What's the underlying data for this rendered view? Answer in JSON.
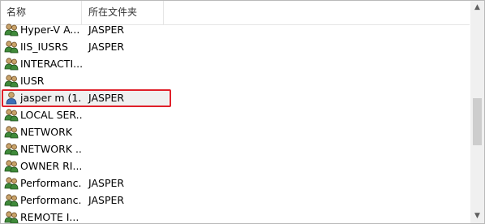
{
  "columns": {
    "name": "名称",
    "folder": "所在文件夹"
  },
  "rows": [
    {
      "name": "Hyper-V A...",
      "folder": "JASPER",
      "icon": "group-icon",
      "selected": false
    },
    {
      "name": "IIS_IUSRS",
      "folder": "JASPER",
      "icon": "group-icon",
      "selected": false
    },
    {
      "name": "INTERACTI...",
      "folder": "",
      "icon": "group-icon",
      "selected": false
    },
    {
      "name": "IUSR",
      "folder": "",
      "icon": "group-icon",
      "selected": false
    },
    {
      "name": "jasper m (1...",
      "folder": "JASPER",
      "icon": "user-icon",
      "selected": true
    },
    {
      "name": "LOCAL SER...",
      "folder": "",
      "icon": "group-icon",
      "selected": false
    },
    {
      "name": "NETWORK",
      "folder": "",
      "icon": "group-icon",
      "selected": false
    },
    {
      "name": "NETWORK ...",
      "folder": "",
      "icon": "group-icon",
      "selected": false
    },
    {
      "name": "OWNER RI...",
      "folder": "",
      "icon": "group-icon",
      "selected": false
    },
    {
      "name": "Performanc...",
      "folder": "JASPER",
      "icon": "group-icon",
      "selected": false
    },
    {
      "name": "Performanc...",
      "folder": "JASPER",
      "icon": "group-icon",
      "selected": false
    },
    {
      "name": "REMOTE I...",
      "folder": "",
      "icon": "group-icon",
      "selected": false
    }
  ],
  "colors": {
    "highlight_border": "#e0202a",
    "selected_bg": "#f0f0f0"
  }
}
